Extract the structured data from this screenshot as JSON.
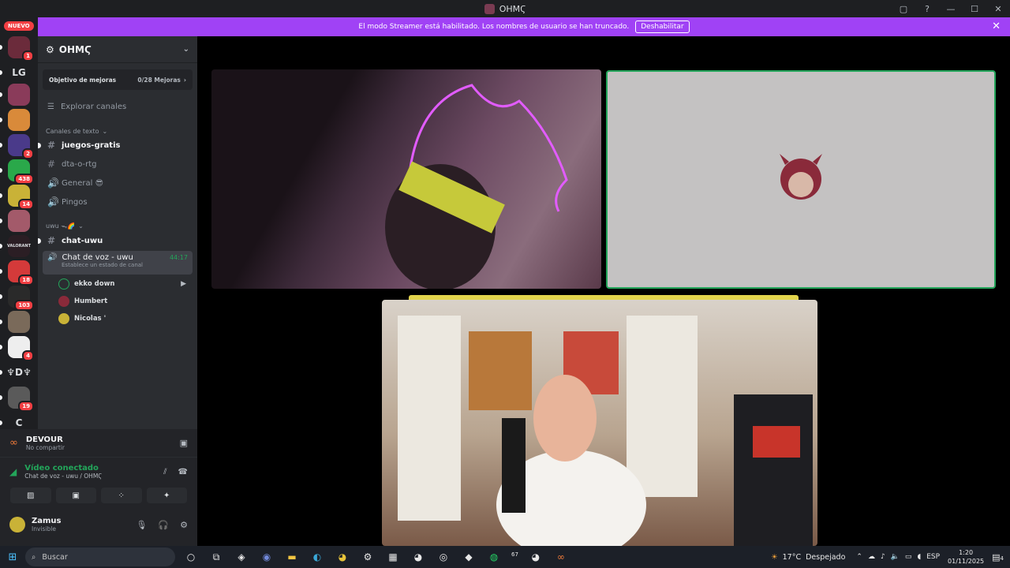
{
  "window": {
    "title": "OHMϚ",
    "controls": [
      "▢",
      "?",
      "—",
      "☐",
      "✕"
    ]
  },
  "banner": {
    "text": "El modo Streamer está habilitado. Los nombres de usuario se han truncado.",
    "button": "Deshabilitar",
    "close": "✕",
    "color": "#a042f5"
  },
  "rail": {
    "nuevo": "NUEVO",
    "servers": [
      {
        "label": "",
        "badge": "1",
        "color": "#6b2b3b"
      },
      {
        "label": "LG",
        "badge": "",
        "color": "#1e1f22"
      },
      {
        "label": "",
        "badge": "",
        "color": "#8a3b5a"
      },
      {
        "label": "",
        "badge": "",
        "color": "#d98a3a"
      },
      {
        "label": "",
        "badge": "2",
        "color": "#4a3a8a"
      },
      {
        "label": "",
        "badge": "438",
        "color": "#2aa84a"
      },
      {
        "label": "",
        "badge": "14",
        "color": "#c9b237"
      },
      {
        "label": "",
        "badge": "",
        "color": "#a35a6a"
      },
      {
        "label": "VALORANT",
        "badge": "",
        "color": "#2b1e24"
      },
      {
        "label": "",
        "badge": "18",
        "color": "#d43a3a"
      },
      {
        "label": "",
        "badge": "103",
        "color": "#2a2a2a"
      },
      {
        "label": "",
        "badge": "",
        "color": "#7a6a5a"
      },
      {
        "label": "",
        "badge": "4",
        "color": "#eeeeee"
      },
      {
        "label": "♆D♆",
        "badge": "",
        "color": "#1e1f22"
      },
      {
        "label": "",
        "badge": "19",
        "color": "#5a5a5a"
      },
      {
        "label": "C",
        "badge": "",
        "color": "#1e1f22"
      }
    ]
  },
  "guild": {
    "name": "OHMϚ",
    "boost_label": "Objetivo de mejoras",
    "boost_progress": "0/28 Mejoras",
    "explore": "Explorar canales",
    "category1": "Canales de texto",
    "channels1": [
      {
        "name": "juegos-gratis",
        "type": "text",
        "unread": true
      },
      {
        "name": "dta-o-rtg",
        "type": "text",
        "unread": false
      },
      {
        "name": "General 😎",
        "type": "voice",
        "unread": false
      },
      {
        "name": "Pingos",
        "type": "voice",
        "unread": false
      }
    ],
    "category2": "uwu ᯓ🌈",
    "channels2": [
      {
        "name": "chat-uwu",
        "type": "text",
        "unread": true
      }
    ],
    "voice_channel": {
      "name": "Chat de voz - uwu",
      "time": "44:17",
      "status": "Establece un estado de canal"
    },
    "voice_users": [
      {
        "name": "ekko down",
        "camera": true,
        "color": "#2b2d31"
      },
      {
        "name": "Humbert",
        "camera": false,
        "color": "#8a2a3a"
      },
      {
        "name": "Nicolas '",
        "camera": false,
        "color": "#c9b237"
      }
    ]
  },
  "panel": {
    "activity_name": "DEVOUR",
    "activity_sub": "No compartir",
    "voice_title": "Vídeo conectado",
    "voice_sub": "Chat de voz - uwu / OHMϚ",
    "user_name": "Zamus",
    "user_status": "Invisible"
  },
  "taskbar": {
    "search": "Buscar",
    "weather_temp": "17°C",
    "weather_text": "Despejado",
    "lang": "ESP",
    "time": "1:20",
    "date": "01/11/2025",
    "badge67": "67",
    "notif": "4"
  }
}
